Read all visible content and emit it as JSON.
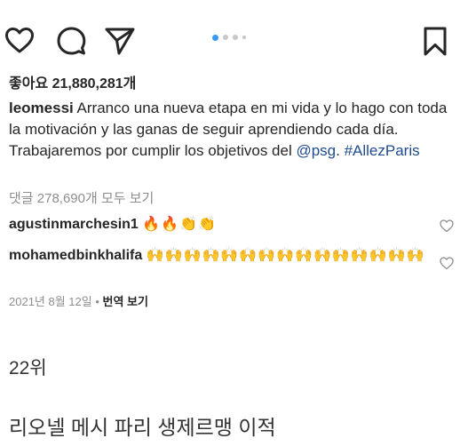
{
  "post": {
    "likes_text": "좋아요 21,880,281개",
    "caption_user": "leomessi",
    "caption_text": " Arranco una nueva etapa en mi vida y lo hago con toda la motivación y las ganas de seguir aprendiendo cada día. Trabajaremos por cumplir los objetivos del ",
    "caption_mention": "@psg",
    "caption_sep": ". ",
    "caption_hashtag": "#AllezParis",
    "view_comments": "댓글 278,690개 모두 보기",
    "comments": [
      {
        "user": "agustinmarchesin1",
        "text": "🔥🔥👏👏"
      },
      {
        "user": "mohamedbinkhalifa",
        "text": "🙌🙌🙌🙌🙌🙌🙌🙌🙌🙌🙌🙌🙌🙌🙌"
      }
    ],
    "date": "2021년 8월 12일",
    "meta_sep": " • ",
    "translate_label": "번역 보기",
    "carousel": {
      "count": 4,
      "active_index": 0
    }
  },
  "article": {
    "rank": "22위",
    "headline": "리오넬 메시 파리 생제르맹 이적"
  },
  "icons": {
    "like": "heart-icon",
    "comment": "comment-icon",
    "share": "paper-plane-icon",
    "save": "bookmark-icon"
  },
  "colors": {
    "text": "#262626",
    "muted": "#8e8e8e",
    "link": "#1e4b8f",
    "active_dot": "#3897f0",
    "inactive_dot": "#c7c7c7"
  }
}
